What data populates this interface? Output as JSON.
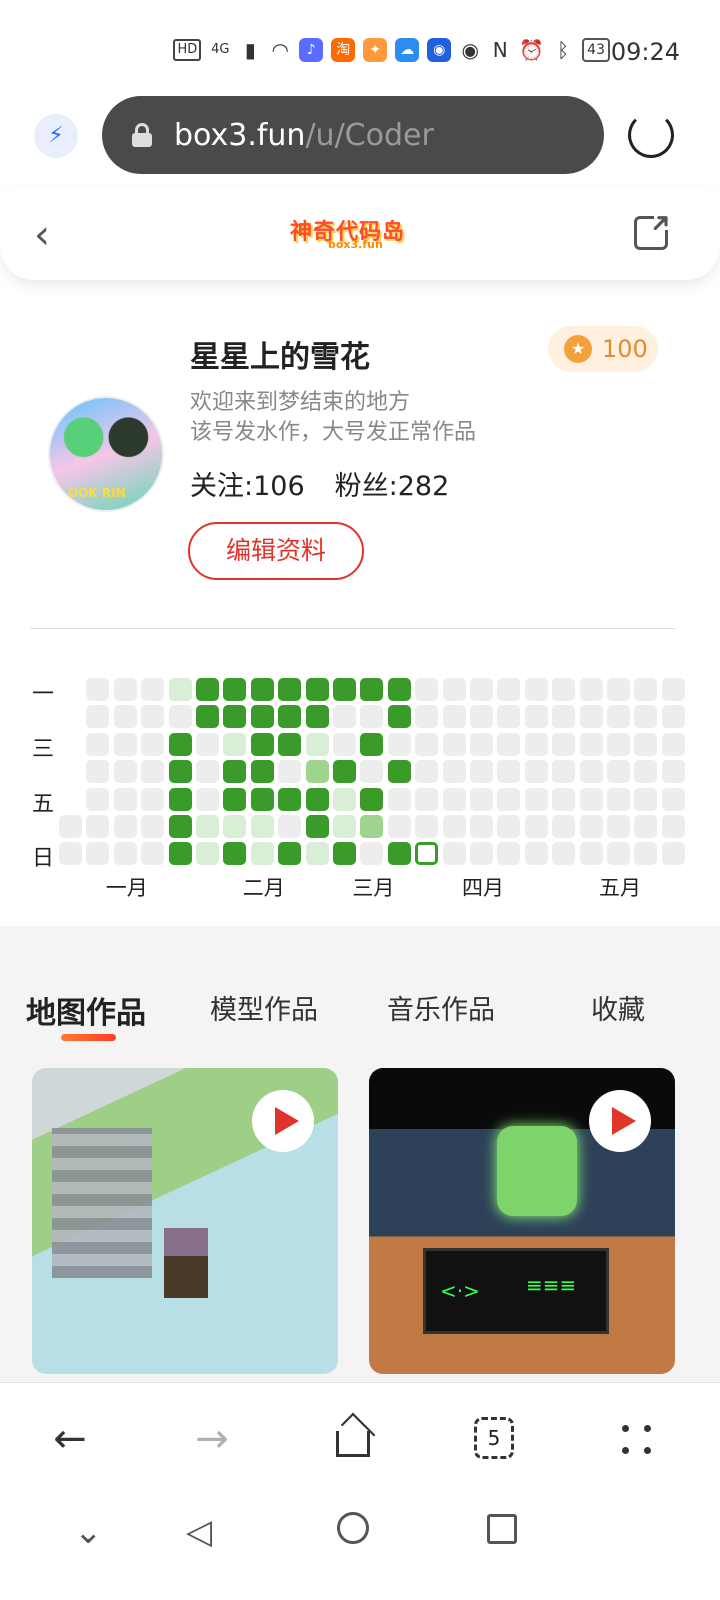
{
  "status_bar": {
    "time": "09:24",
    "battery": "43",
    "network": "4G",
    "hd_label": "HD",
    "icons": [
      "hd-icon",
      "signal-icon",
      "wifi-icon",
      "music-app-icon",
      "taobao-app-icon",
      "app-icon",
      "cloud-app-icon",
      "bulb-app-icon",
      "eye-icon",
      "nfc-icon",
      "alarm-icon",
      "bluetooth-icon",
      "battery-icon"
    ],
    "taobao_char": "淘"
  },
  "browser": {
    "url_host": "box3.fun",
    "url_path": "/u/Coder",
    "accent": "#2d6cf0"
  },
  "header": {
    "logo_text": "神奇代码岛",
    "logo_sub": "box3.fun",
    "back_glyph": "‹",
    "share_glyph": "➜"
  },
  "profile": {
    "username": "星星上的雪花",
    "points": "100",
    "bio_line1": "欢迎来到梦结束的地方",
    "bio_line2": "该号发水作，大号发正常作品",
    "following": "关注:106",
    "followers": "粉丝:282",
    "edit_button": "编辑资料",
    "avatar_caption": "OOK RIN"
  },
  "heatmap": {
    "weekdays": [
      {
        "label": "一",
        "row": 0
      },
      {
        "label": "三",
        "row": 2
      },
      {
        "label": "五",
        "row": 4
      },
      {
        "label": "日",
        "row": 6
      }
    ],
    "months": [
      {
        "label": "一月",
        "col": 2
      },
      {
        "label": "二月",
        "col": 7
      },
      {
        "label": "三月",
        "col": 11
      },
      {
        "label": "四月",
        "col": 15
      },
      {
        "label": "五月",
        "col": 20
      }
    ],
    "colors": {
      "0": "#ededed",
      "1": "#d8eed6",
      "2": "#9fd48e",
      "3": "#3a9a2a",
      "today": "#ffffff"
    },
    "rows": [
      "-0001333333330000000000",
      "-0000333330030000000000",
      "-0003013310300000000000",
      "-0003033023030000000000",
      "-0003033331300000000000",
      "00003111031200000000000",
      "0000313131303t000000000"
    ]
  },
  "works": {
    "tabs": [
      "地图作品",
      "模型作品",
      "音乐作品",
      "收藏"
    ],
    "active_tab": 0,
    "cards": [
      {
        "name": "map-card-1"
      },
      {
        "name": "map-card-2",
        "board_left": "<·>",
        "board_right": "≡≡≡"
      }
    ]
  },
  "bottom_nav": {
    "back": "←",
    "forward": "→",
    "tabs_count": "5"
  },
  "system_nav": {
    "collapse": "⌄",
    "back": "◁"
  }
}
